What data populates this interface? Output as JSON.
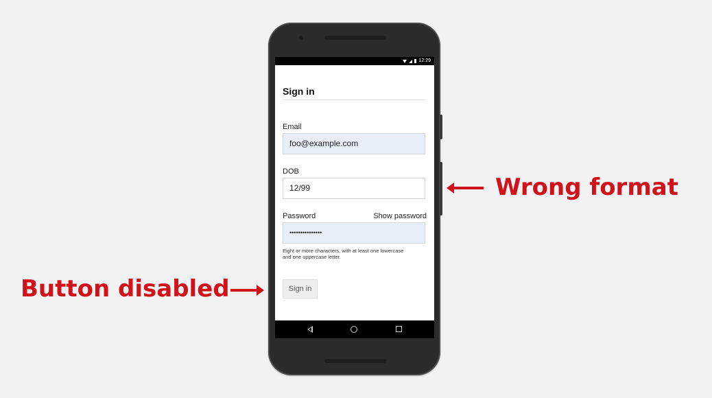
{
  "status_bar": {
    "time": "12:29"
  },
  "form": {
    "title": "Sign in",
    "email_label": "Email",
    "email_value": "foo@example.com",
    "dob_label": "DOB",
    "dob_value": "12/99",
    "password_label": "Password",
    "show_password_label": "Show password",
    "password_value": "•••••••••••••••",
    "hint": "Eight or more characters, with at least one lowercase and one uppercase letter.",
    "submit_label": "Sign in"
  },
  "annotations": {
    "wrong_format": "Wrong format",
    "button_disabled": "Button disabled",
    "color": "#d0121b"
  },
  "icons": [
    "wifi-icon",
    "signal-icon",
    "battery-icon",
    "back-icon",
    "home-icon",
    "recents-icon"
  ]
}
